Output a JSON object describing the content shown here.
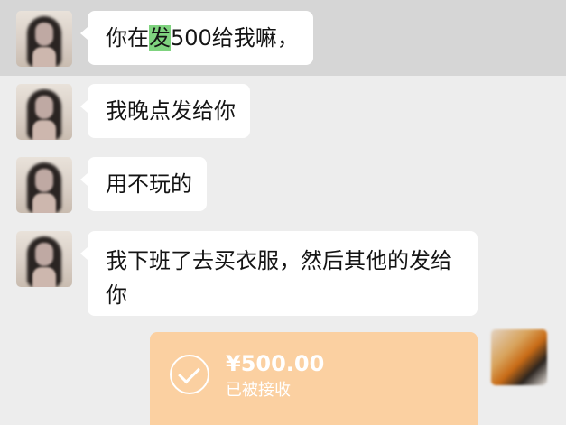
{
  "messages": [
    {
      "sender": "contact",
      "text_before": "你在",
      "highlight": "发",
      "text_after": "500给我嘛，",
      "highlighted_row": true
    },
    {
      "sender": "contact",
      "text": "我晚点发给你"
    },
    {
      "sender": "contact",
      "text": "用不玩的"
    },
    {
      "sender": "contact",
      "text": "我下班了去买衣服，然后其他的发给你"
    }
  ],
  "transfer": {
    "amount": "¥500.00",
    "status": "已被接收",
    "icon": "check-circle-icon",
    "bg_color": "#fbd0a1"
  },
  "colors": {
    "chat_bg": "#ededed",
    "highlight_row_bg": "#d6d6d6",
    "bubble_bg": "#ffffff",
    "search_highlight": "#7fd37f"
  }
}
